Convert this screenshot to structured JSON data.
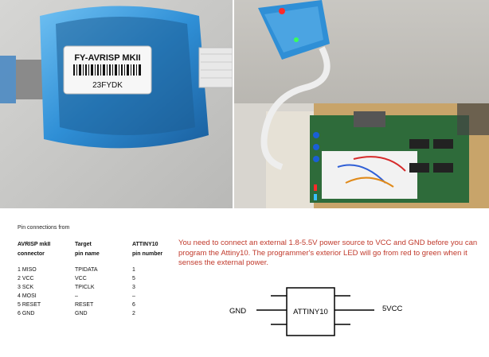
{
  "photos": {
    "left": {
      "label_line1": "FY-AVRISP MKII",
      "label_line2": "23FYDK"
    }
  },
  "pinout": {
    "title": "Pin connections from",
    "headers": [
      [
        "AVRISP mkII",
        "connector"
      ],
      [
        "Target",
        "pin name"
      ],
      [
        "ATTINY10",
        "pin number"
      ]
    ],
    "rows": [
      [
        "1 MISO",
        "TPIDATA",
        "1"
      ],
      [
        "2 VCC",
        "VCC",
        "5"
      ],
      [
        "3 SCK",
        "TPICLK",
        "3"
      ],
      [
        "4 MOSI",
        "–",
        "–"
      ],
      [
        "5 RESET",
        "RESET",
        "6"
      ],
      [
        "6 GND",
        "GND",
        "2"
      ]
    ]
  },
  "note": "You need to connect an external 1.8-5.5V power source to VCC and GND before you can program the  Attiny10. The programmer's exterior LED will go from red to green when it senses the external power.",
  "diagram": {
    "chip_label": "ATTINY10",
    "left_pin_label": "GND",
    "right_pin_label": "5VCC"
  },
  "colors": {
    "note_text": "#c0392b",
    "programmer_blue": "#2f8fd6",
    "pcb_green": "#2e6b3a",
    "led_red": "#ff2a2a",
    "led_green": "#39ff5a"
  }
}
